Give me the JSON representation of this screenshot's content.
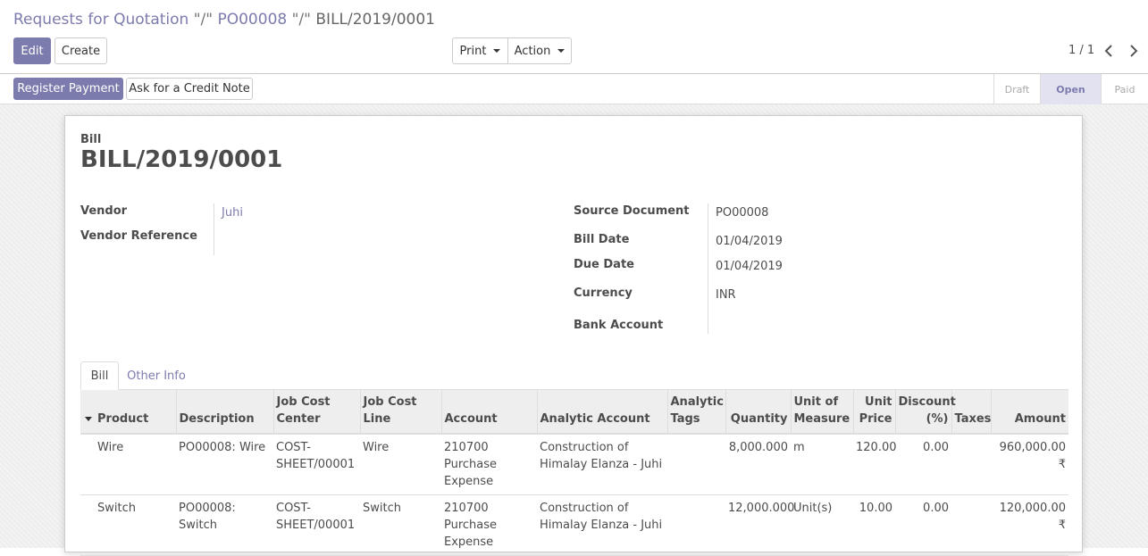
{
  "breadcrumb": {
    "parent": "Requests for Quotation",
    "sep1": "\"/\"",
    "po": "PO00008",
    "sep2": "\"/\"",
    "current": "BILL/2019/0001"
  },
  "toolbar": {
    "edit_label": "Edit",
    "create_label": "Create",
    "print_label": "Print",
    "action_label": "Action"
  },
  "pager": {
    "value": "1 / 1",
    "prev_icon": "chevron-left-icon",
    "next_icon": "chevron-right-icon"
  },
  "header_buttons": {
    "register_payment": "Register Payment",
    "credit_note": "Ask for a Credit Note"
  },
  "status": {
    "steps": [
      "Draft",
      "Open",
      "Paid"
    ],
    "active": "Open"
  },
  "colors": {
    "accent": "#7c7bad",
    "status_active_bg": "#e2e2f0"
  },
  "doc": {
    "type": "Bill",
    "name": "BILL/2019/0001"
  },
  "fields": {
    "vendor_label": "Vendor",
    "vendor_value": "Juhi",
    "vendor_ref_label": "Vendor Reference",
    "source_label": "Source Document",
    "source_value": "PO00008",
    "bill_date_label": "Bill Date",
    "bill_date_value": "01/04/2019",
    "due_date_label": "Due Date",
    "due_date_value": "01/04/2019",
    "currency_label": "Currency",
    "currency_value": "INR",
    "bank_label": "Bank Account"
  },
  "tabs": [
    "Bill",
    "Other Info"
  ],
  "table": {
    "headers": [
      "Product",
      "Description",
      "Job Cost Center",
      "Job Cost Line",
      "Account",
      "Analytic Account",
      "Analytic Tags",
      "Quantity",
      "Unit of Measure",
      "Unit Price",
      "Discount (%)",
      "Taxes",
      "Amount"
    ],
    "rows": [
      {
        "product": "Wire",
        "description": "PO00008: Wire",
        "job_cost_center": "COST-SHEET/00001",
        "job_cost_line": "Wire",
        "account": "210700 Purchase Expense",
        "analytic_account": "Construction of Himalay Elanza - Juhi",
        "analytic_tags": "",
        "quantity": "8,000.000",
        "uom": "m",
        "unit_price": "120.00",
        "discount": "0.00",
        "taxes": "",
        "amount": "960,000.00 ₹"
      },
      {
        "product": "Switch",
        "description": "PO00008: Switch",
        "job_cost_center": "COST-SHEET/00001",
        "job_cost_line": "Switch",
        "account": "210700 Purchase Expense",
        "analytic_account": "Construction of Himalay Elanza - Juhi",
        "analytic_tags": "",
        "quantity": "12,000.000",
        "uom": "Unit(s)",
        "unit_price": "10.00",
        "discount": "0.00",
        "taxes": "",
        "amount": "120,000.00 ₹"
      }
    ]
  }
}
